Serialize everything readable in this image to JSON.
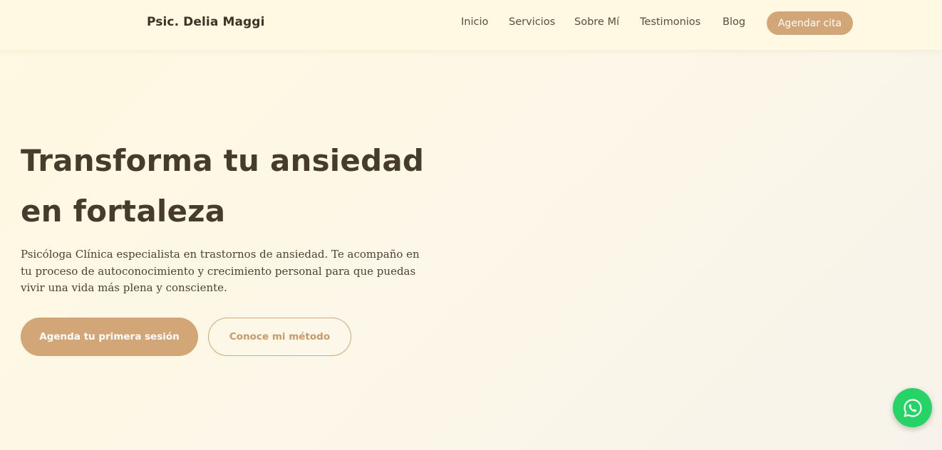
{
  "header": {
    "brand": "Psic. Delia Maggi",
    "nav": [
      {
        "label": "Inicio"
      },
      {
        "label": "Servicios"
      },
      {
        "label": "Sobre Mí"
      },
      {
        "label": "Testimonios"
      },
      {
        "label": "Blog"
      }
    ],
    "cta_label": "Agendar cita"
  },
  "hero": {
    "title_line1": "Transforma tu ansiedad",
    "title_line2": "en fortaleza",
    "description": "Psicóloga Clínica especialista en trastornos de ansiedad. Te acompaño en tu proceso de autoconocimiento y crecimiento personal para que puedas vivir una vida más plena y consciente.",
    "primary_button": "Agenda tu primera sesión",
    "secondary_button": "Conoce mi método"
  },
  "floating": {
    "icon": "whatsapp-icon"
  },
  "colors": {
    "accent": "#d3a677",
    "header_bg": "#fff8e3",
    "text_dark": "#473c2b",
    "whatsapp": "#25d366"
  }
}
